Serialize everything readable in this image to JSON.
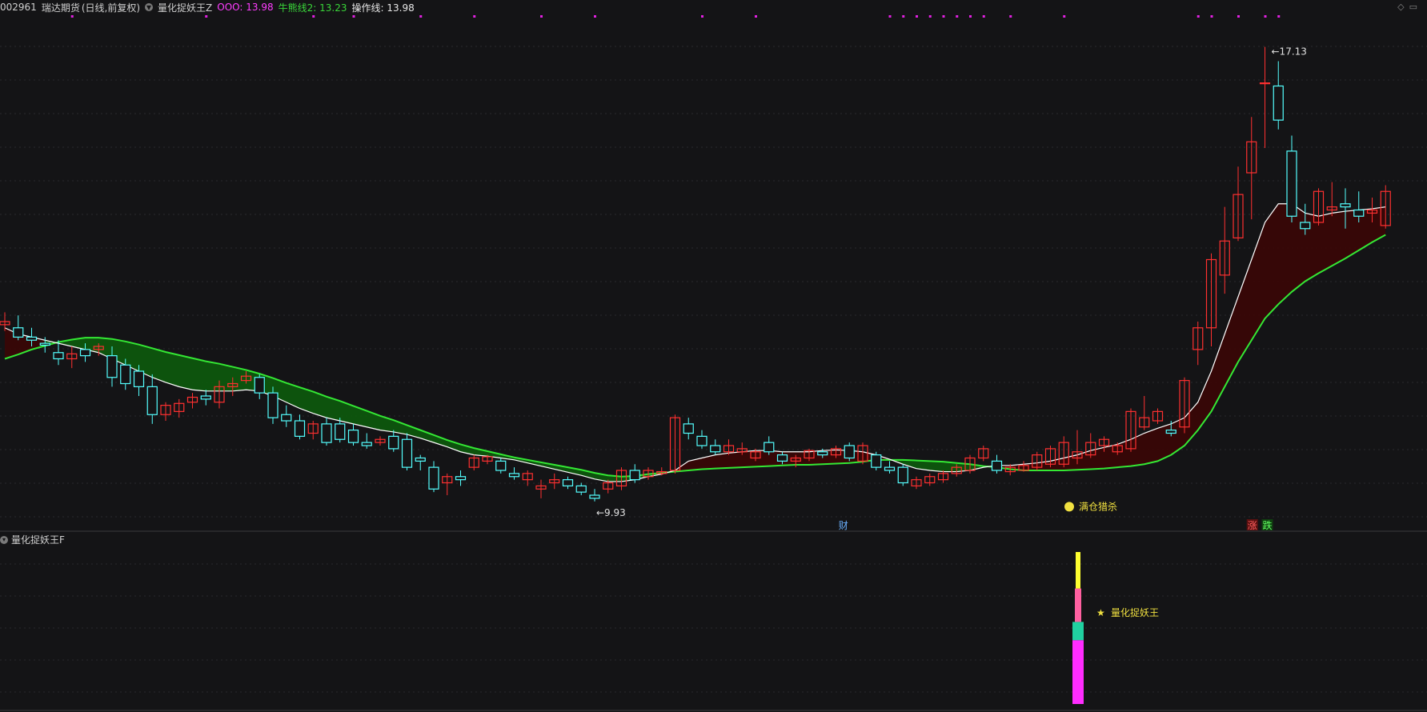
{
  "header": {
    "code": "002961",
    "name": "瑞达期货",
    "period": "(日线,前复权)",
    "indicator_name": "量化捉妖王Z",
    "legend": [
      {
        "label": "OOO:",
        "value": "13.98",
        "color": "#ff3dff"
      },
      {
        "label": "牛熊线2:",
        "value": "13.23",
        "color": "#39d639"
      },
      {
        "label": "操作线:",
        "value": "13.98",
        "color": "#e8e8e8"
      }
    ]
  },
  "sub_header": {
    "indicator_name": "量化捉妖王F"
  },
  "corner_icons": [
    "diamond-icon",
    "expand-icon"
  ],
  "colors": {
    "up": "#ff3030",
    "down": "#54ffff",
    "bull_band": "#0c5a0c",
    "bear_band": "#3a0505",
    "ma_green": "#34e834",
    "ma_white": "#ffffff",
    "dot": "#e020e0",
    "grid": "#2a2a2e",
    "label": "#e6e6b0",
    "marker": "#f0e040"
  },
  "annotations": {
    "high_label": "17.13",
    "low_label": "9.93",
    "signal_label": "满仓猎杀",
    "event_labels": [
      "财",
      "涨",
      "跌"
    ],
    "sub_signal_label": "量化捉妖王"
  },
  "chart_data": {
    "type": "candlestick",
    "price_range": [
      9.5,
      17.5
    ],
    "grid": true,
    "candles": [
      [
        12.65,
        12.85,
        12.55,
        12.7
      ],
      [
        12.6,
        12.8,
        12.4,
        12.45
      ],
      [
        12.45,
        12.6,
        12.3,
        12.4
      ],
      [
        12.35,
        12.45,
        12.2,
        12.32
      ],
      [
        12.2,
        12.4,
        12.0,
        12.1
      ],
      [
        12.1,
        12.3,
        11.95,
        12.18
      ],
      [
        12.25,
        12.35,
        12.05,
        12.15
      ],
      [
        12.25,
        12.35,
        12.15,
        12.3
      ],
      [
        12.15,
        12.3,
        11.65,
        11.8
      ],
      [
        12.0,
        12.1,
        11.6,
        11.7
      ],
      [
        11.9,
        12.0,
        11.5,
        11.65
      ],
      [
        11.65,
        11.85,
        11.05,
        11.2
      ],
      [
        11.2,
        11.4,
        11.1,
        11.35
      ],
      [
        11.25,
        11.45,
        11.15,
        11.38
      ],
      [
        11.4,
        11.55,
        11.3,
        11.48
      ],
      [
        11.5,
        11.6,
        11.35,
        11.45
      ],
      [
        11.4,
        11.75,
        11.3,
        11.65
      ],
      [
        11.65,
        11.8,
        11.5,
        11.7
      ],
      [
        11.75,
        11.9,
        11.7,
        11.82
      ],
      [
        11.8,
        11.85,
        11.45,
        11.55
      ],
      [
        11.55,
        11.65,
        11.05,
        11.15
      ],
      [
        11.2,
        11.35,
        11.0,
        11.1
      ],
      [
        11.1,
        11.2,
        10.8,
        10.85
      ],
      [
        10.9,
        11.1,
        10.8,
        11.05
      ],
      [
        11.05,
        11.15,
        10.7,
        10.75
      ],
      [
        11.05,
        11.15,
        10.75,
        10.8
      ],
      [
        10.95,
        11.05,
        10.7,
        10.75
      ],
      [
        10.75,
        10.9,
        10.65,
        10.7
      ],
      [
        10.75,
        10.85,
        10.7,
        10.8
      ],
      [
        10.85,
        10.95,
        10.6,
        10.65
      ],
      [
        10.8,
        10.9,
        10.3,
        10.35
      ],
      [
        10.5,
        10.55,
        10.3,
        10.45
      ],
      [
        10.35,
        10.45,
        9.95,
        10.0
      ],
      [
        10.1,
        10.25,
        9.9,
        10.2
      ],
      [
        10.2,
        10.3,
        10.05,
        10.15
      ],
      [
        10.35,
        10.55,
        10.3,
        10.5
      ],
      [
        10.45,
        10.55,
        10.4,
        10.52
      ],
      [
        10.45,
        10.5,
        10.25,
        10.3
      ],
      [
        10.25,
        10.35,
        10.15,
        10.2
      ],
      [
        10.15,
        10.3,
        10.05,
        10.25
      ],
      [
        10.0,
        10.15,
        9.85,
        10.05
      ],
      [
        10.1,
        10.25,
        10.0,
        10.15
      ],
      [
        10.15,
        10.2,
        10.0,
        10.05
      ],
      [
        10.05,
        10.1,
        9.9,
        9.95
      ],
      [
        9.9,
        10.0,
        9.8,
        9.85
      ],
      [
        10.0,
        10.15,
        9.93,
        10.1
      ],
      [
        10.05,
        10.35,
        9.98,
        10.3
      ],
      [
        10.3,
        10.4,
        10.1,
        10.15
      ],
      [
        10.2,
        10.35,
        10.15,
        10.3
      ],
      [
        10.25,
        10.35,
        10.22,
        10.28
      ],
      [
        10.3,
        11.2,
        10.25,
        11.15
      ],
      [
        11.05,
        11.15,
        10.8,
        10.9
      ],
      [
        10.85,
        10.95,
        10.65,
        10.7
      ],
      [
        10.7,
        10.8,
        10.55,
        10.6
      ],
      [
        10.6,
        10.8,
        10.55,
        10.7
      ],
      [
        10.6,
        10.75,
        10.55,
        10.65
      ],
      [
        10.5,
        10.65,
        10.45,
        10.6
      ],
      [
        10.75,
        10.85,
        10.55,
        10.6
      ],
      [
        10.55,
        10.6,
        10.4,
        10.45
      ],
      [
        10.45,
        10.55,
        10.35,
        10.5
      ],
      [
        10.5,
        10.65,
        10.45,
        10.62
      ],
      [
        10.6,
        10.65,
        10.5,
        10.55
      ],
      [
        10.55,
        10.7,
        10.5,
        10.65
      ],
      [
        10.7,
        10.75,
        10.45,
        10.5
      ],
      [
        10.45,
        10.75,
        10.4,
        10.7
      ],
      [
        10.55,
        10.6,
        10.3,
        10.35
      ],
      [
        10.35,
        10.45,
        10.25,
        10.3
      ],
      [
        10.35,
        10.4,
        10.05,
        10.1
      ],
      [
        10.05,
        10.2,
        10.0,
        10.15
      ],
      [
        10.1,
        10.25,
        10.05,
        10.2
      ],
      [
        10.15,
        10.3,
        10.1,
        10.25
      ],
      [
        10.25,
        10.4,
        10.2,
        10.35
      ],
      [
        10.3,
        10.55,
        10.25,
        10.5
      ],
      [
        10.5,
        10.7,
        10.45,
        10.65
      ],
      [
        10.45,
        10.55,
        10.25,
        10.3
      ],
      [
        10.28,
        10.4,
        10.22,
        10.35
      ],
      [
        10.3,
        10.45,
        10.28,
        10.38
      ],
      [
        10.35,
        10.6,
        10.3,
        10.55
      ],
      [
        10.4,
        10.7,
        10.35,
        10.65
      ],
      [
        10.4,
        10.85,
        10.35,
        10.75
      ],
      [
        10.5,
        10.95,
        10.4,
        10.6
      ],
      [
        10.55,
        10.9,
        10.5,
        10.75
      ],
      [
        10.7,
        10.85,
        10.6,
        10.8
      ],
      [
        10.6,
        10.75,
        10.55,
        10.7
      ],
      [
        10.65,
        11.3,
        10.6,
        11.25
      ],
      [
        11.0,
        11.5,
        10.95,
        11.15
      ],
      [
        11.1,
        11.3,
        11.05,
        11.25
      ],
      [
        10.95,
        11.1,
        10.85,
        10.9
      ],
      [
        11.0,
        11.8,
        10.9,
        11.75
      ],
      [
        12.25,
        12.7,
        12.0,
        12.6
      ],
      [
        12.6,
        13.8,
        12.3,
        13.7
      ],
      [
        13.45,
        14.55,
        13.15,
        14.0
      ],
      [
        14.05,
        15.2,
        14.0,
        14.75
      ],
      [
        15.1,
        16.0,
        14.35,
        15.6
      ],
      [
        16.55,
        17.13,
        15.5,
        16.55
      ],
      [
        16.5,
        16.9,
        15.8,
        15.95
      ],
      [
        15.45,
        15.7,
        14.3,
        14.4
      ],
      [
        14.3,
        14.6,
        14.1,
        14.2
      ],
      [
        14.3,
        14.85,
        14.25,
        14.8
      ],
      [
        14.5,
        14.95,
        14.4,
        14.55
      ],
      [
        14.6,
        14.85,
        14.2,
        14.55
      ],
      [
        14.5,
        14.8,
        14.3,
        14.4
      ],
      [
        14.45,
        14.7,
        14.3,
        14.5
      ],
      [
        14.25,
        14.9,
        14.2,
        14.8
      ]
    ],
    "ma_white": [
      12.6,
      12.5,
      12.45,
      12.4,
      12.35,
      12.3,
      12.25,
      12.2,
      12.1,
      12.0,
      11.9,
      11.8,
      11.72,
      11.65,
      11.6,
      11.58,
      11.58,
      11.58,
      11.6,
      11.58,
      11.5,
      11.4,
      11.3,
      11.22,
      11.15,
      11.1,
      11.05,
      11.0,
      10.95,
      10.92,
      10.88,
      10.82,
      10.75,
      10.68,
      10.6,
      10.55,
      10.53,
      10.5,
      10.47,
      10.42,
      10.37,
      10.32,
      10.27,
      10.22,
      10.16,
      10.12,
      10.12,
      10.15,
      10.2,
      10.24,
      10.3,
      10.45,
      10.5,
      10.55,
      10.58,
      10.6,
      10.62,
      10.62,
      10.6,
      10.6,
      10.6,
      10.62,
      10.63,
      10.62,
      10.6,
      10.55,
      10.48,
      10.4,
      10.33,
      10.3,
      10.28,
      10.28,
      10.3,
      10.35,
      10.38,
      10.38,
      10.4,
      10.42,
      10.45,
      10.5,
      10.55,
      10.62,
      10.67,
      10.72,
      10.8,
      10.9,
      10.98,
      11.05,
      11.15,
      11.4,
      11.9,
      12.5,
      13.1,
      13.7,
      14.3,
      14.6,
      14.6,
      14.45,
      14.4,
      14.45,
      14.48,
      14.5,
      14.52,
      14.55
    ],
    "ma_green": [
      12.1,
      12.17,
      12.25,
      12.31,
      12.37,
      12.41,
      12.44,
      12.44,
      12.42,
      12.38,
      12.33,
      12.27,
      12.21,
      12.16,
      12.11,
      12.06,
      12.02,
      11.97,
      11.92,
      11.86,
      11.79,
      11.71,
      11.64,
      11.57,
      11.49,
      11.42,
      11.34,
      11.26,
      11.18,
      11.11,
      11.03,
      10.95,
      10.87,
      10.79,
      10.72,
      10.66,
      10.61,
      10.56,
      10.51,
      10.47,
      10.43,
      10.39,
      10.35,
      10.31,
      10.26,
      10.22,
      10.2,
      10.21,
      10.24,
      10.26,
      10.28,
      10.3,
      10.32,
      10.33,
      10.34,
      10.35,
      10.36,
      10.37,
      10.38,
      10.39,
      10.39,
      10.4,
      10.41,
      10.42,
      10.44,
      10.47,
      10.47,
      10.47,
      10.46,
      10.45,
      10.44,
      10.42,
      10.4,
      10.37,
      10.35,
      10.32,
      10.3,
      10.3,
      10.3,
      10.3,
      10.31,
      10.32,
      10.33,
      10.35,
      10.37,
      10.4,
      10.45,
      10.55,
      10.7,
      10.95,
      11.25,
      11.65,
      12.05,
      12.4,
      12.75,
      12.98,
      13.18,
      13.35,
      13.48,
      13.6,
      13.72,
      13.85,
      13.98,
      14.1
    ],
    "dots": [
      5,
      15,
      23,
      26,
      31,
      35,
      40,
      44,
      52,
      56,
      66,
      67,
      68,
      69,
      70,
      71,
      72,
      73,
      75,
      79,
      89,
      90,
      92,
      94,
      95
    ],
    "sub_bars": [
      {
        "color": "#ff2cff",
        "value": 0.42
      },
      {
        "color": "#20d0a0",
        "value": 0.12
      },
      {
        "color": "#ff60a0",
        "value": 0.22
      },
      {
        "color": "#ffff30",
        "value": 0.24
      }
    ]
  }
}
